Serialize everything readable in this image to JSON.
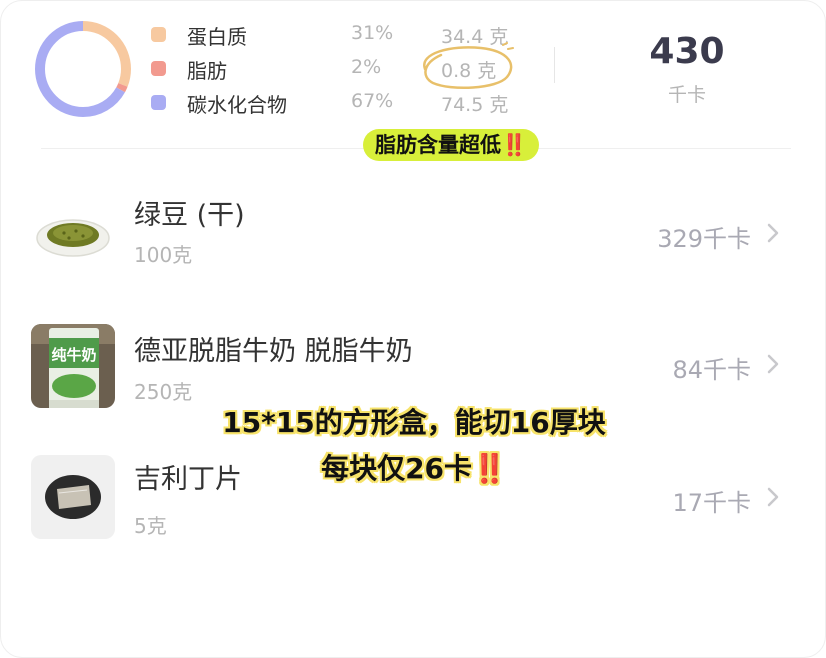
{
  "summary": {
    "macros": [
      {
        "name": "蛋白质",
        "percent": "31%",
        "amount": "34.4 克",
        "color": "#f7c9a0"
      },
      {
        "name": "脂肪",
        "percent": "2%",
        "amount": "0.8 克",
        "color": "#f29a8f"
      },
      {
        "name": "碳水化合物",
        "percent": "67%",
        "amount": "74.5 克",
        "color": "#a9acf3"
      }
    ],
    "total_kcal": "430",
    "total_unit": "千卡",
    "donut": {
      "segments": [
        31,
        2,
        67
      ],
      "colors": [
        "#f7c9a0",
        "#f29a8f",
        "#a9acf3"
      ]
    },
    "highlight": "脂肪含量超低",
    "highlight_mark": "‼️"
  },
  "foods": [
    {
      "name": "绿豆 (干)",
      "quantity": "100克",
      "kcal": "329千卡",
      "icon": "mung-bean-plate-photo"
    },
    {
      "name": "德亚脱脂牛奶 脱脂牛奶",
      "quantity": "250克",
      "kcal": "84千卡",
      "icon": "milk-carton-photo",
      "carton_text": "纯牛奶"
    },
    {
      "name": "吉利丁片",
      "quantity": "5克",
      "kcal": "17千卡",
      "icon": "gelatin-sheet-photo"
    }
  ],
  "overlay": {
    "line1": "15*15的方形盒，能切16厚块",
    "line2": "每块仅26卡",
    "line2_mark": "‼️",
    "color": "#f7e36a"
  }
}
